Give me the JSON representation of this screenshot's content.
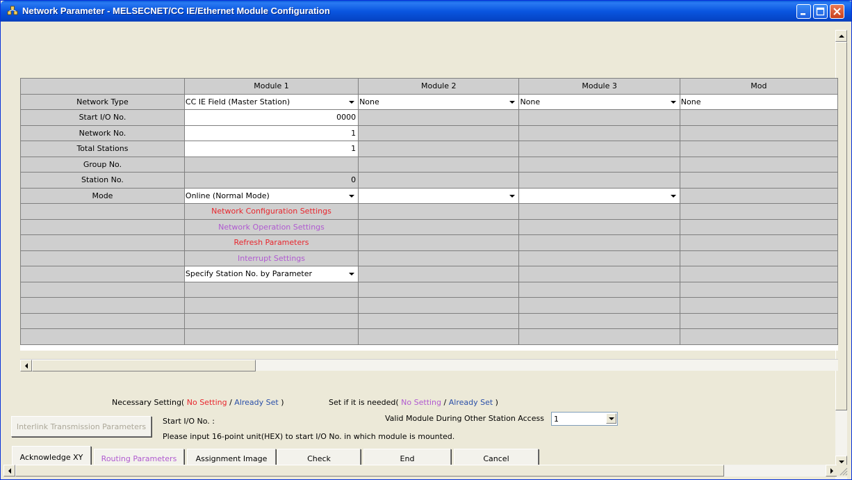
{
  "window": {
    "title": "Network Parameter - MELSECNET/CC IE/Ethernet Module Configuration"
  },
  "grid": {
    "columns": [
      "Module 1",
      "Module 2",
      "Module 3",
      "Mod"
    ],
    "rows": {
      "network_type": {
        "label": "Network Type",
        "values": [
          "CC IE Field (Master Station)",
          "None",
          "None",
          "None"
        ]
      },
      "start_io": {
        "label": "Start I/O No.",
        "value": "0000"
      },
      "network_no": {
        "label": "Network No.",
        "value": "1"
      },
      "total_stations": {
        "label": "Total Stations",
        "value": "1"
      },
      "group_no": {
        "label": "Group No.",
        "value": ""
      },
      "station_no": {
        "label": "Station No.",
        "value": "0"
      },
      "mode": {
        "label": "Mode",
        "value": "Online (Normal Mode)"
      },
      "net_config": {
        "label": "Network Configuration Settings"
      },
      "net_operation": {
        "label": "Network Operation Settings"
      },
      "refresh": {
        "label": "Refresh Parameters"
      },
      "interrupt": {
        "label": "Interrupt Settings"
      },
      "specify_station": {
        "value": "Specify Station No. by Parameter"
      }
    }
  },
  "legend": {
    "necessary_prefix": "Necessary Setting(",
    "no_setting": "No Setting",
    "slash": "/",
    "already_set": "Already Set",
    "close": ")",
    "ifneeded_prefix": "Set if it is needed("
  },
  "bottom": {
    "start_io_label": "Start I/O No. :",
    "instruction": "Please input 16-point unit(HEX) to start I/O No. in which module is mounted.",
    "valid_module_label": "Valid Module During Other Station Access",
    "valid_module_value": "1",
    "interlink_button": "Interlink Transmission Parameters",
    "acknowledge_button": "Acknowledge XY",
    "routing_button": "Routing Parameters",
    "assignment_button": "Assignment Image",
    "check_button": "Check",
    "end_button": "End",
    "cancel_button": "Cancel"
  },
  "colors": {
    "no_setting": "#e8262d",
    "ifneeded_no_setting": "#b05ad0",
    "already_set": "#2a4fa8",
    "titlebar": "#0a56e0"
  },
  "icons": [
    "network-app-icon",
    "minimize-icon",
    "maximize-icon",
    "close-icon",
    "chevron-down-icon",
    "arrow-up-icon",
    "arrow-down-icon",
    "arrow-left-icon",
    "arrow-right-icon",
    "resize-grip-icon"
  ]
}
